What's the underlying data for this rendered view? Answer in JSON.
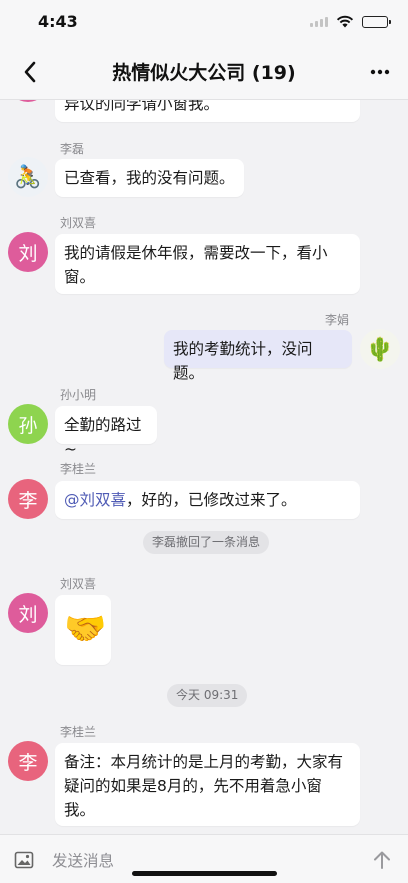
{
  "status": {
    "time": "4:43",
    "battery_level": 0.85
  },
  "nav": {
    "title": "热情似火大公司 (19)",
    "back_icon": "chevron-left-icon",
    "more_icon": "ellipsis-icon"
  },
  "messages": [
    {
      "type": "partial",
      "text": "异议的同学请小窗我。"
    },
    {
      "type": "in",
      "sender": "李磊",
      "avatar_kind": "cyclist-emoji",
      "avatar_emoji": "🚴",
      "lines": [
        "已查看，我的没有问题。"
      ]
    },
    {
      "type": "in",
      "sender": "刘双喜",
      "avatar_text": "刘",
      "avatar_color": "#de5c9b",
      "lines": [
        "我的请假是休年假，需要改一下，看小",
        "窗。"
      ]
    },
    {
      "type": "out",
      "sender": "李娟",
      "avatar_kind": "cactus-emoji",
      "avatar_emoji": "🌵",
      "lines": [
        "我的考勤统计，没问题。"
      ]
    },
    {
      "type": "in",
      "sender": "孙小明",
      "avatar_text": "孙",
      "avatar_color": "#8ed44f",
      "lines": [
        "全勤的路过~"
      ]
    },
    {
      "type": "in",
      "sender": "李桂兰",
      "avatar_text": "李",
      "avatar_color": "#e8647d",
      "mention": "@刘双喜",
      "text_after_mention": "，好的，已修改过来了。"
    },
    {
      "type": "system",
      "text": "李磊撤回了一条消息"
    },
    {
      "type": "in",
      "sender": "刘双喜",
      "avatar_text": "刘",
      "avatar_color": "#de5c9b",
      "emoji": "🤝"
    },
    {
      "type": "time",
      "text": "今天 09:31"
    },
    {
      "type": "in",
      "sender": "李桂兰",
      "avatar_text": "李",
      "avatar_color": "#e8647d",
      "lines": [
        "备注：本月统计的是上月的考勤，大家有",
        "疑问的如果是8月的，先不用着急小窗",
        "我。"
      ]
    }
  ],
  "input": {
    "placeholder": "发送消息",
    "image_icon": "image-icon",
    "send_icon": "arrow-up-icon"
  }
}
